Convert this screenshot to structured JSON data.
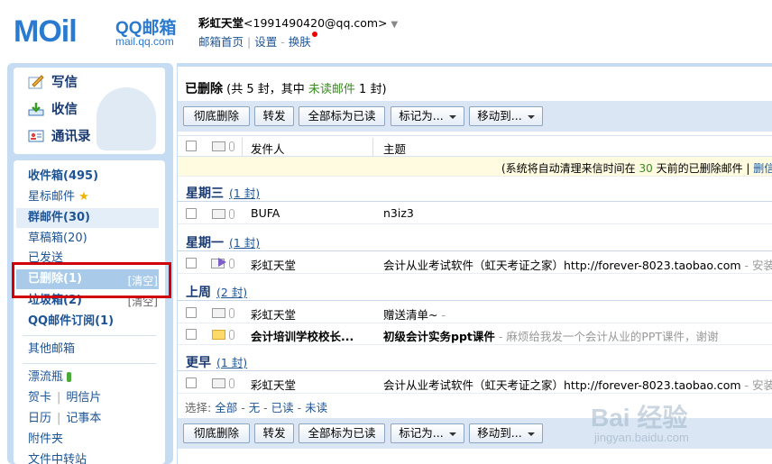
{
  "header": {
    "logo_text": "MOil",
    "brand": "QQ邮箱",
    "brand_domain": "mail.qq.com",
    "user_name": "彩虹天堂",
    "user_email": "<1991490420@qq.com>",
    "links": [
      "邮箱首页",
      "设置",
      "换肤"
    ]
  },
  "quick_actions": [
    {
      "label": "写信",
      "icon": "compose-icon"
    },
    {
      "label": "收信",
      "icon": "inbox-download-icon"
    },
    {
      "label": "通讯录",
      "icon": "contacts-icon"
    }
  ],
  "folders": {
    "inbox": "收件箱(495)",
    "starred": "星标邮件",
    "group": "群邮件(30)",
    "drafts": "草稿箱(20)",
    "sent": "已发送",
    "deleted": "已删除(1)",
    "deleted_clear": "[清空]",
    "spam": "垃圾箱(2)",
    "spam_clear": "[清空]",
    "subscriptions": "QQ邮件订阅(1)",
    "other": "其他邮箱",
    "drift_bottle": "漂流瓶",
    "cards": "贺卡",
    "postcards": "明信片",
    "calendar": "日历",
    "notes": "记事本",
    "attachments": "附件夹",
    "file_transfer": "文件中转站"
  },
  "main": {
    "folder_title": "已删除",
    "summary_prefix": "(共 5 封，其中 ",
    "summary_unread": "未读邮件",
    "summary_suffix": " 1 封)",
    "toolbar": {
      "delete_forever": "彻底删除",
      "forward": "转发",
      "mark_all_read": "全部标为已读",
      "mark_as": "标记为...",
      "move_to": "移动到..."
    },
    "columns": {
      "from": "发件人",
      "subject": "主题"
    },
    "notice": {
      "prefix": "(系统将自动清理来信时间在 ",
      "days": "30",
      "suffix": " 天前的已删除邮件 | ",
      "link": "删信"
    },
    "groups": [
      {
        "label": "星期三",
        "count": "(1 封)"
      },
      {
        "label": "星期一",
        "count": "(1 封)"
      },
      {
        "label": "上周",
        "count": "(2 封)"
      },
      {
        "label": "更早",
        "count": "(1 封)"
      }
    ],
    "emails": [
      {
        "from": "BUFA",
        "subject": "n3iz3",
        "preview": ""
      },
      {
        "from": "彩虹天堂",
        "subject": "会计从业考试软件（虹天考证之家）http://forever-8023.taobao.com",
        "preview": " - 安装"
      },
      {
        "from": "彩虹天堂",
        "subject": "赠送清单~",
        "preview": " -"
      },
      {
        "from": "会计培训学校校长...",
        "subject": "初级会计实务ppt课件",
        "preview": " - 麻烦给我发一个会计从业的PPT课件，谢谢"
      },
      {
        "from": "彩虹天堂",
        "subject": "会计从业考试软件（虹天考证之家）http://forever-8023.taobao.com",
        "preview": " - 安装"
      }
    ],
    "select": {
      "label": "选择:",
      "all": "全部",
      "none": "无",
      "read": "已读",
      "unread": "未读"
    }
  },
  "watermark": {
    "line1": "Bai 经验",
    "line2": "jingyan.baidu.com"
  }
}
